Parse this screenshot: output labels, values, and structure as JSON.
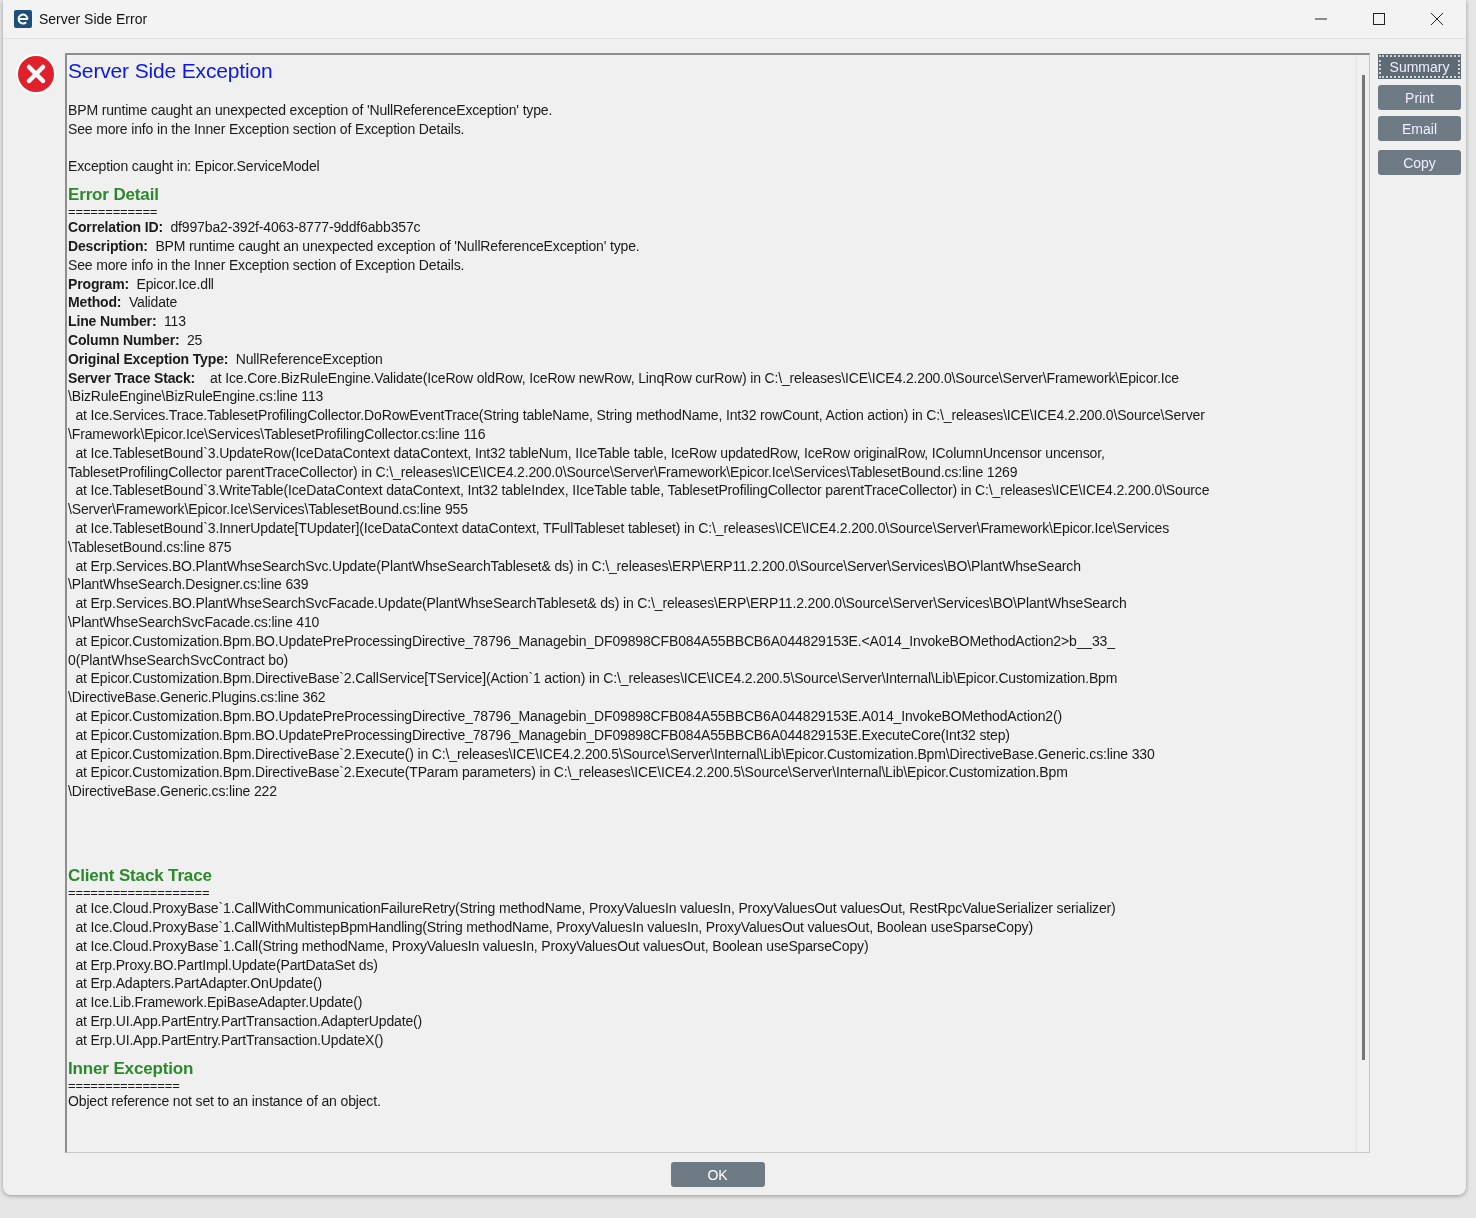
{
  "window": {
    "title": "Server Side Error"
  },
  "title": "Server Side Exception",
  "intro": [
    "BPM runtime caught an unexpected exception of 'NullReferenceException' type.",
    "See more info in the Inner Exception section of Exception Details."
  ],
  "caught_in": "Exception caught in: Epicor.ServiceModel",
  "error_detail": {
    "heading": "Error Detail",
    "rule": "============",
    "fields": [
      {
        "label": "Correlation ID:",
        "value": "df997ba2-392f-4063-8777-9ddf6abb357c"
      },
      {
        "label": "Description:",
        "value": "BPM runtime caught an unexpected exception of 'NullReferenceException' type.\nSee more info in the Inner Exception section of Exception Details."
      },
      {
        "label": "Program:",
        "value": "Epicor.Ice.dll"
      },
      {
        "label": "Method:",
        "value": "Validate"
      },
      {
        "label": "Line Number:",
        "value": "113"
      },
      {
        "label": "Column Number:",
        "value": "25"
      },
      {
        "label": "Original Exception Type:",
        "value": "NullReferenceException"
      }
    ],
    "server_trace_label": "Server Trace Stack:",
    "server_trace": [
      "at Ice.Core.BizRuleEngine.Validate(IceRow oldRow, IceRow newRow, LinqRow curRow) in C:\\_releases\\ICE\\ICE4.2.200.0\\Source\\Server\\Framework\\Epicor.Ice\n\\BizRuleEngine\\BizRuleEngine.cs:line 113",
      "at Ice.Services.Trace.TablesetProfilingCollector.DoRowEventTrace(String tableName, String methodName, Int32 rowCount, Action action) in C:\\_releases\\ICE\\ICE4.2.200.0\\Source\\Server\n\\Framework\\Epicor.Ice\\Services\\TablesetProfilingCollector.cs:line 116",
      "at Ice.TablesetBound`3.UpdateRow(IceDataContext dataContext, Int32 tableNum, IIceTable table, IceRow updatedRow, IceRow originalRow, IColumnUncensor uncensor,\nTablesetProfilingCollector parentTraceCollector) in C:\\_releases\\ICE\\ICE4.2.200.0\\Source\\Server\\Framework\\Epicor.Ice\\Services\\TablesetBound.cs:line 1269",
      "at Ice.TablesetBound`3.WriteTable(IceDataContext dataContext, Int32 tableIndex, IIceTable table, TablesetProfilingCollector parentTraceCollector) in C:\\_releases\\ICE\\ICE4.2.200.0\\Source\n\\Server\\Framework\\Epicor.Ice\\Services\\TablesetBound.cs:line 955",
      "at Ice.TablesetBound`3.InnerUpdate[TUpdater](IceDataContext dataContext, TFullTableset tableset) in C:\\_releases\\ICE\\ICE4.2.200.0\\Source\\Server\\Framework\\Epicor.Ice\\Services\n\\TablesetBound.cs:line 875",
      "at Erp.Services.BO.PlantWhseSearchSvc.Update(PlantWhseSearchTableset& ds) in C:\\_releases\\ERP\\ERP11.2.200.0\\Source\\Server\\Services\\BO\\PlantWhseSearch\n\\PlantWhseSearch.Designer.cs:line 639",
      "at Erp.Services.BO.PlantWhseSearchSvcFacade.Update(PlantWhseSearchTableset& ds) in C:\\_releases\\ERP\\ERP11.2.200.0\\Source\\Server\\Services\\BO\\PlantWhseSearch\n\\PlantWhseSearchSvcFacade.cs:line 410",
      "at Epicor.Customization.Bpm.BO.UpdatePreProcessingDirective_78796_Managebin_DF09898CFB084A55BBCB6A044829153E.<A014_InvokeBOMethodAction2>b__33_\n0(PlantWhseSearchSvcContract bo)",
      "at Epicor.Customization.Bpm.DirectiveBase`2.CallService[TService](Action`1 action) in C:\\_releases\\ICE\\ICE4.2.200.5\\Source\\Server\\Internal\\Lib\\Epicor.Customization.Bpm\n\\DirectiveBase.Generic.Plugins.cs:line 362",
      "at Epicor.Customization.Bpm.BO.UpdatePreProcessingDirective_78796_Managebin_DF09898CFB084A55BBCB6A044829153E.A014_InvokeBOMethodAction2()",
      "at Epicor.Customization.Bpm.BO.UpdatePreProcessingDirective_78796_Managebin_DF09898CFB084A55BBCB6A044829153E.ExecuteCore(Int32 step)",
      "at Epicor.Customization.Bpm.DirectiveBase`2.Execute() in C:\\_releases\\ICE\\ICE4.2.200.5\\Source\\Server\\Internal\\Lib\\Epicor.Customization.Bpm\\DirectiveBase.Generic.cs:line 330",
      "at Epicor.Customization.Bpm.DirectiveBase`2.Execute(TParam parameters) in C:\\_releases\\ICE\\ICE4.2.200.5\\Source\\Server\\Internal\\Lib\\Epicor.Customization.Bpm\n\\DirectiveBase.Generic.cs:line 222"
    ]
  },
  "client_stack_trace": {
    "heading": "Client Stack Trace",
    "rule": "===================",
    "frames": [
      "at Ice.Cloud.ProxyBase`1.CallWithCommunicationFailureRetry(String methodName, ProxyValuesIn valuesIn, ProxyValuesOut valuesOut, RestRpcValueSerializer serializer)",
      "at Ice.Cloud.ProxyBase`1.CallWithMultistepBpmHandling(String methodName, ProxyValuesIn valuesIn, ProxyValuesOut valuesOut, Boolean useSparseCopy)",
      "at Ice.Cloud.ProxyBase`1.Call(String methodName, ProxyValuesIn valuesIn, ProxyValuesOut valuesOut, Boolean useSparseCopy)",
      "at Erp.Proxy.BO.PartImpl.Update(PartDataSet ds)",
      "at Erp.Adapters.PartAdapter.OnUpdate()",
      "at Ice.Lib.Framework.EpiBaseAdapter.Update()",
      "at Erp.UI.App.PartEntry.PartTransaction.AdapterUpdate()",
      "at Erp.UI.App.PartEntry.PartTransaction.UpdateX()"
    ]
  },
  "inner_exception": {
    "heading": "Inner Exception",
    "rule": "===============",
    "message": "Object reference not set to an instance of an object."
  },
  "side_buttons": [
    {
      "label": "Summary",
      "selected": true
    },
    {
      "label": "Print",
      "selected": false
    },
    {
      "label": "Email",
      "selected": false
    },
    {
      "label": "Copy",
      "selected": false
    }
  ],
  "ok_button": "OK"
}
